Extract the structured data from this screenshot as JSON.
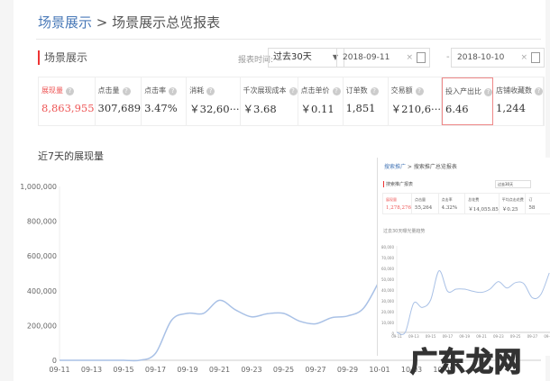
{
  "breadcrumb": {
    "parent": "场景展示",
    "separator": ">",
    "current": "场景展示总览报表"
  },
  "section_title": "场景展示",
  "filter": {
    "label": "报表时间:",
    "range": "过去30天",
    "start": "2018-09-11",
    "end": "2018-10-10",
    "separator": "-",
    "clear": "×"
  },
  "kpis": [
    {
      "label": "展现量",
      "value": "8,863,955",
      "active": true
    },
    {
      "label": "点击量",
      "value": "307,689"
    },
    {
      "label": "点击率",
      "value": "3.47%"
    },
    {
      "label": "消耗",
      "value": "￥32,60···"
    },
    {
      "label": "千次展现成本",
      "value": "￥3.68"
    },
    {
      "label": "点击单价",
      "value": "￥0.11"
    },
    {
      "label": "订单数",
      "value": "1,851"
    },
    {
      "label": "交易额",
      "value": "￥210,6···"
    },
    {
      "label": "投入产出比",
      "value": "6.46",
      "highlighted": true
    },
    {
      "label": "店铺收藏数",
      "value": "1,244"
    }
  ],
  "help_icon": "?",
  "chart_title": "近7天的展现量",
  "chart_data": [
    {
      "type": "line",
      "ylim": [
        0,
        1000000
      ],
      "yticks": [
        "0",
        "200,000",
        "400,000",
        "600,000",
        "800,000",
        "1,000,000"
      ],
      "xticks": [
        "09-11",
        "09-13",
        "09-15",
        "09-17",
        "09-19",
        "09-21",
        "09-23",
        "09-25",
        "09-27",
        "09-29",
        "10-01",
        "10-03",
        "10-05"
      ],
      "x": [
        "09-11",
        "09-12",
        "09-13",
        "09-14",
        "09-15",
        "09-16",
        "09-17",
        "09-18",
        "09-19",
        "09-20",
        "09-21",
        "09-22",
        "09-23",
        "09-24",
        "09-25",
        "09-26",
        "09-27",
        "09-28",
        "09-29",
        "09-30",
        "10-01"
      ],
      "values": [
        0,
        0,
        0,
        0,
        0,
        0,
        40000,
        230000,
        270000,
        270000,
        345000,
        290000,
        250000,
        268000,
        270000,
        225000,
        210000,
        245000,
        255000,
        300000,
        460000
      ],
      "color": "#a9c1e6"
    },
    {
      "type": "line",
      "title": "过去30天曝光量趋势",
      "ylim": [
        0,
        80000
      ],
      "yticks": [
        "0",
        "10,000",
        "20,000",
        "30,000",
        "40,000",
        "50,000",
        "60,000",
        "70,000",
        "80,000"
      ],
      "xticks": [
        "09-11",
        "09-13",
        "09-15",
        "09-17",
        "09-19",
        "09-21",
        "09-23",
        "09-25",
        "09-27",
        "09-29"
      ],
      "x": [
        "09-11",
        "09-12",
        "09-13",
        "09-14",
        "09-15",
        "09-16",
        "09-17",
        "09-18",
        "09-19",
        "09-20",
        "09-21",
        "09-22",
        "09-23",
        "09-24",
        "09-25",
        "09-26",
        "09-27",
        "09-28",
        "09-29"
      ],
      "values": [
        0,
        0,
        27000,
        23000,
        30000,
        57000,
        38000,
        40000,
        40000,
        38000,
        37000,
        40000,
        47000,
        41000,
        46000,
        45000,
        32000,
        35000,
        55000
      ],
      "color": "#a9c1e6"
    }
  ],
  "inset": {
    "breadcrumb_parent": "搜索推广",
    "breadcrumb_current": "搜索推广总览报表",
    "section_title": "搜索推广报表",
    "range": "过去30天",
    "kpis": [
      {
        "label": "展现量",
        "value": "1,278,276"
      },
      {
        "label": "点击量",
        "value": "55,264"
      },
      {
        "label": "点击率",
        "value": "4.32%"
      },
      {
        "label": "总花费",
        "value": "￥14,055.85"
      },
      {
        "label": "平均点击花费",
        "value": "￥0.25"
      },
      {
        "label": "订",
        "value": "58"
      }
    ]
  },
  "watermark": "广东龙网"
}
